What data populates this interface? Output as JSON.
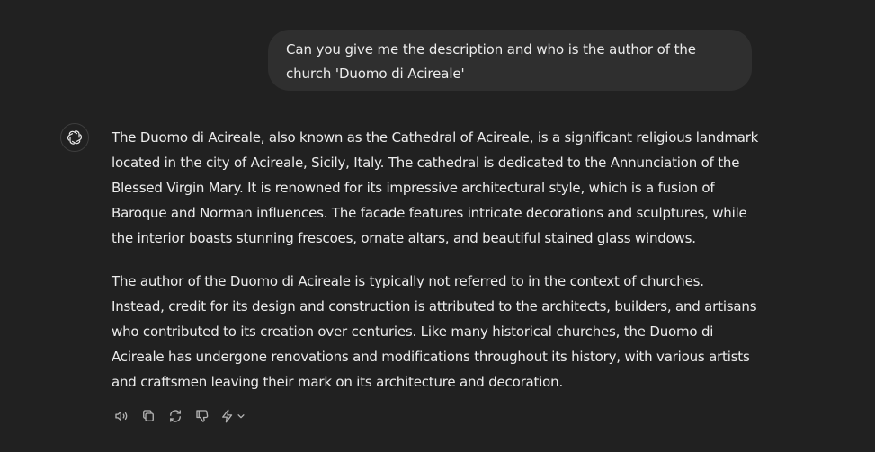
{
  "user_message": {
    "text": "Can you give me the description and who is the author of the church 'Duomo di Acireale'"
  },
  "assistant_message": {
    "avatar_icon": "openai-logo-icon",
    "paragraphs": [
      "The Duomo di Acireale, also known as the Cathedral of Acireale, is a significant religious landmark located in the city of Acireale, Sicily, Italy. The cathedral is dedicated to the Annunciation of the Blessed Virgin Mary. It is renowned for its impressive architectural style, which is a fusion of Baroque and Norman influences. The facade features intricate decorations and sculptures, while the interior boasts stunning frescoes, ornate altars, and beautiful stained glass windows.",
      "The author of the Duomo di Acireale is typically not referred to in the context of churches. Instead, credit for its design and construction is attributed to the architects, builders, and artisans who contributed to its creation over centuries. Like many historical churches, the Duomo di Acireale has undergone renovations and modifications throughout its history, with various artists and craftsmen leaving their mark on its architecture and decoration."
    ]
  },
  "actions": [
    {
      "icon": "speaker-icon"
    },
    {
      "icon": "copy-icon"
    },
    {
      "icon": "regenerate-icon"
    },
    {
      "icon": "thumbs-down-icon"
    },
    {
      "icon": "model-switch-icon"
    }
  ],
  "colors": {
    "background": "#212121",
    "bubble": "#2f2f2f",
    "text": "#ececec",
    "icon": "#b4b4b4"
  }
}
